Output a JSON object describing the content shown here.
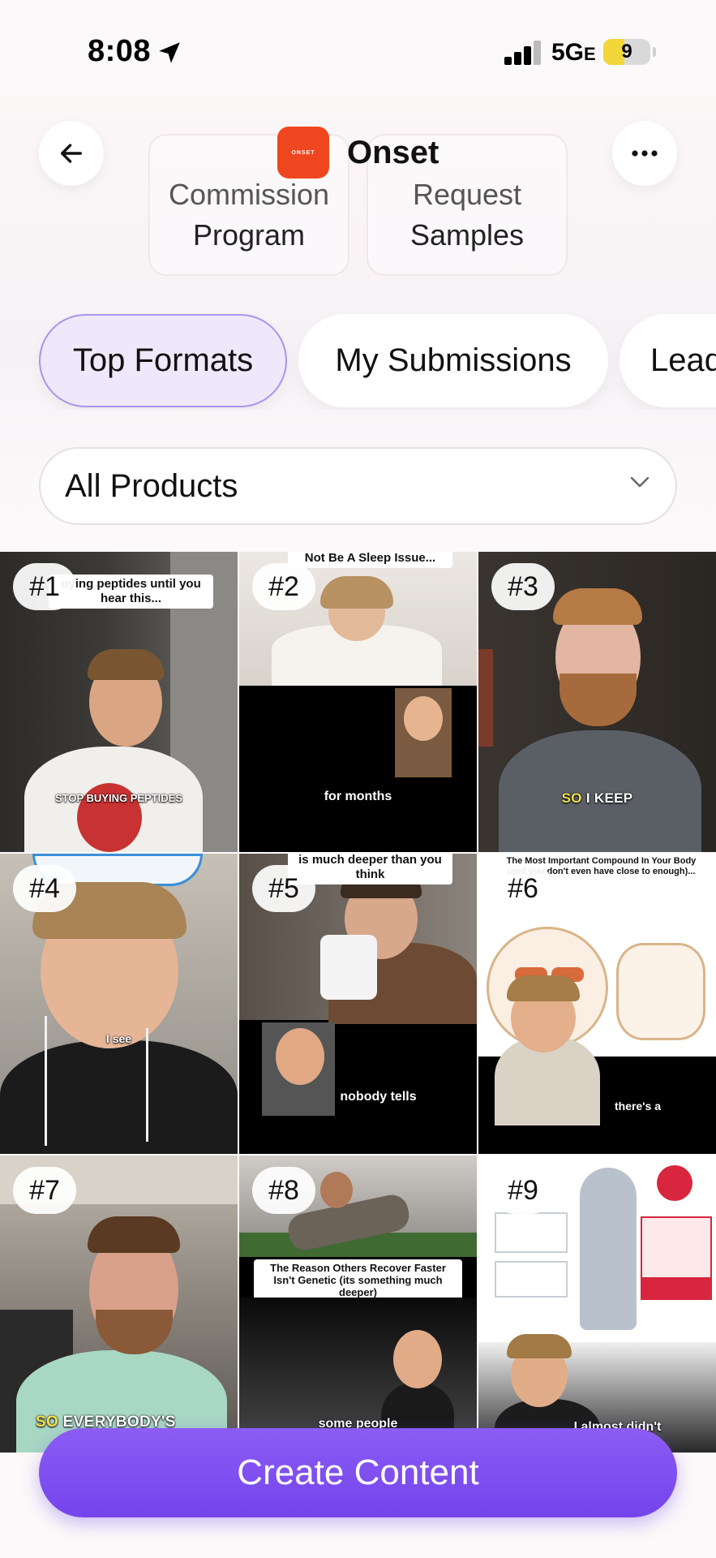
{
  "status": {
    "time": "8:08",
    "network": "5G",
    "network_suffix": "E",
    "battery": "9"
  },
  "header": {
    "brand": "Onset",
    "brand_logo_text": "ONSET"
  },
  "actions": [
    {
      "line1": "Commission",
      "line2": "Program"
    },
    {
      "line1": "Request",
      "line2": "Samples"
    }
  ],
  "tabs": [
    "Top Formats",
    "My Submissions",
    "Lead"
  ],
  "filter": {
    "selected": "All Products"
  },
  "formats": [
    {
      "rank": "#1",
      "top_caption": "uying peptides until you hear this...",
      "caption": "STOP BUYING PEPTIDES"
    },
    {
      "rank": "#2",
      "top_caption": "Not Be A Sleep Issue...",
      "caption": "for months"
    },
    {
      "rank": "#3",
      "caption_hl": "SO",
      "caption": "I KEEP"
    },
    {
      "rank": "#4",
      "caption": "I see"
    },
    {
      "rank": "#5",
      "top_caption": "is much deeper than you think",
      "caption": "nobody tells"
    },
    {
      "rank": "#6",
      "top_caption": "The Most Important Compound In Your Body (and you don't even have close to enough)...",
      "caption": "there's a"
    },
    {
      "rank": "#7",
      "caption_hl": "SO",
      "caption": "EVERYBODY'S"
    },
    {
      "rank": "#8",
      "top_caption": "The Reason Others Recover Faster Isn't Genetic (its something much deeper)",
      "caption": "some people"
    },
    {
      "rank": "#9",
      "caption": "I almost didn't"
    }
  ],
  "cta": {
    "label": "Create Content"
  },
  "colors": {
    "accent": "#7c4dff",
    "brand": "#f0461f",
    "active_tab_bg": "#eee8fb"
  }
}
